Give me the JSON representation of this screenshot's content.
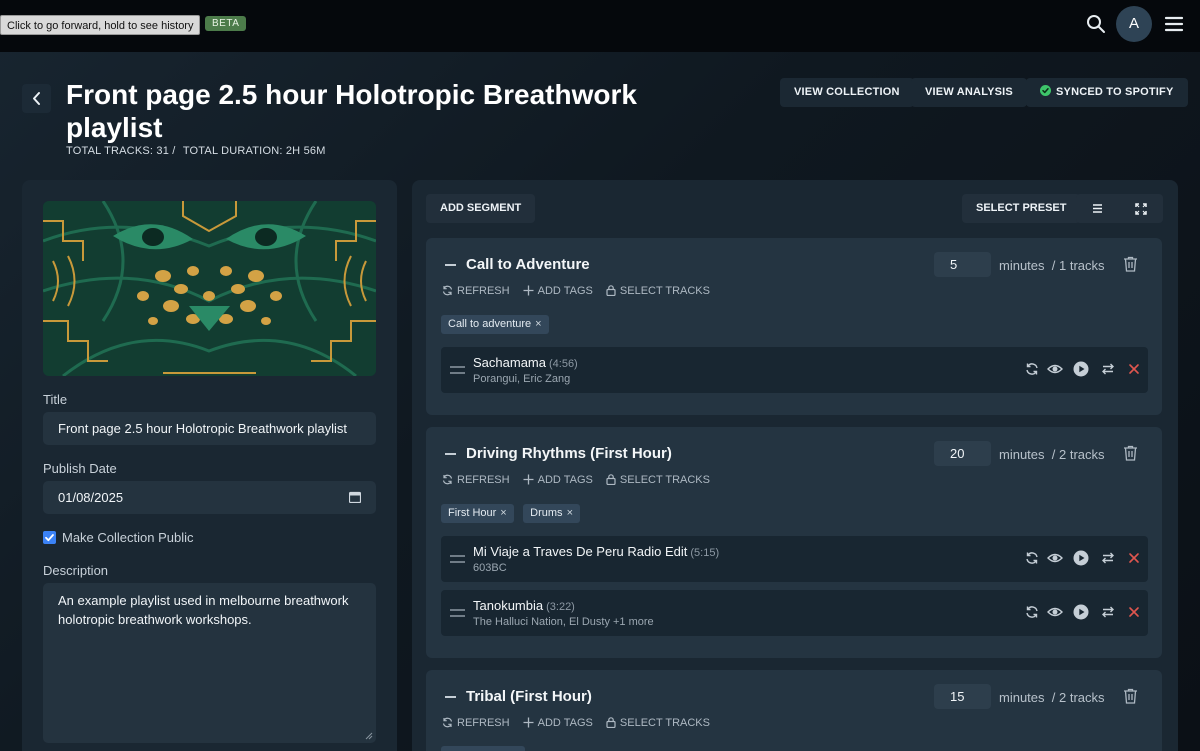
{
  "topbar": {
    "tooltip": "Click to go forward, hold to see history",
    "beta": "BETA",
    "avatar_initial": "A",
    "icons": [
      "search-icon",
      "hamburger-menu-icon"
    ]
  },
  "header": {
    "title": "Front page 2.5 hour Holotropic Breathwork playlist",
    "total_tracks": "TOTAL TRACKS: 31 /",
    "total_duration": "TOTAL DURATION: 2H 56M",
    "view_collection": "VIEW COLLECTION",
    "view_analysis": "VIEW ANALYSIS",
    "synced": "SYNCED TO SPOTIFY",
    "synced_color": "#3ec56a"
  },
  "form": {
    "title_label": "Title",
    "title_value": "Front page 2.5 hour Holotropic Breathwork playlist",
    "publish_label": "Publish Date",
    "publish_value": "01/08/2025",
    "public_label": "Make Collection Public",
    "public_checked": true,
    "description_label": "Description",
    "description_value": "An example playlist used in melbourne breathwork holotropic breathwork workshops."
  },
  "toolbar": {
    "add_segment": "ADD SEGMENT",
    "select_preset": "SELECT PRESET"
  },
  "actions": {
    "refresh": "REFRESH",
    "add_tags": "ADD TAGS",
    "select_tracks": "SELECT TRACKS"
  },
  "segments": [
    {
      "title": "Call to Adventure",
      "minutes": "5",
      "minutes_label": "minutes",
      "tracks_label": "/ 1 tracks",
      "tags": [
        "Call to adventure"
      ],
      "tracks": [
        {
          "name": "Sachamama",
          "duration": "(4:56)",
          "artist": "Porangui, Eric Zang"
        }
      ]
    },
    {
      "title": "Driving Rhythms (First Hour)",
      "minutes": "20",
      "minutes_label": "minutes",
      "tracks_label": "/ 2 tracks",
      "tags": [
        "First Hour",
        "Drums"
      ],
      "tracks": [
        {
          "name": "Mi Viaje a Traves De Peru Radio Edit",
          "duration": "(5:15)",
          "artist": "603BC"
        },
        {
          "name": "Tanokumbia",
          "duration": "(3:22)",
          "artist": "The Halluci Nation, El Dusty +1 more"
        }
      ]
    },
    {
      "title": "Tribal (First Hour)",
      "minutes": "15",
      "minutes_label": "minutes",
      "tracks_label": "/ 2 tracks",
      "tags": [],
      "tracks": []
    }
  ],
  "tag_remove": "×"
}
